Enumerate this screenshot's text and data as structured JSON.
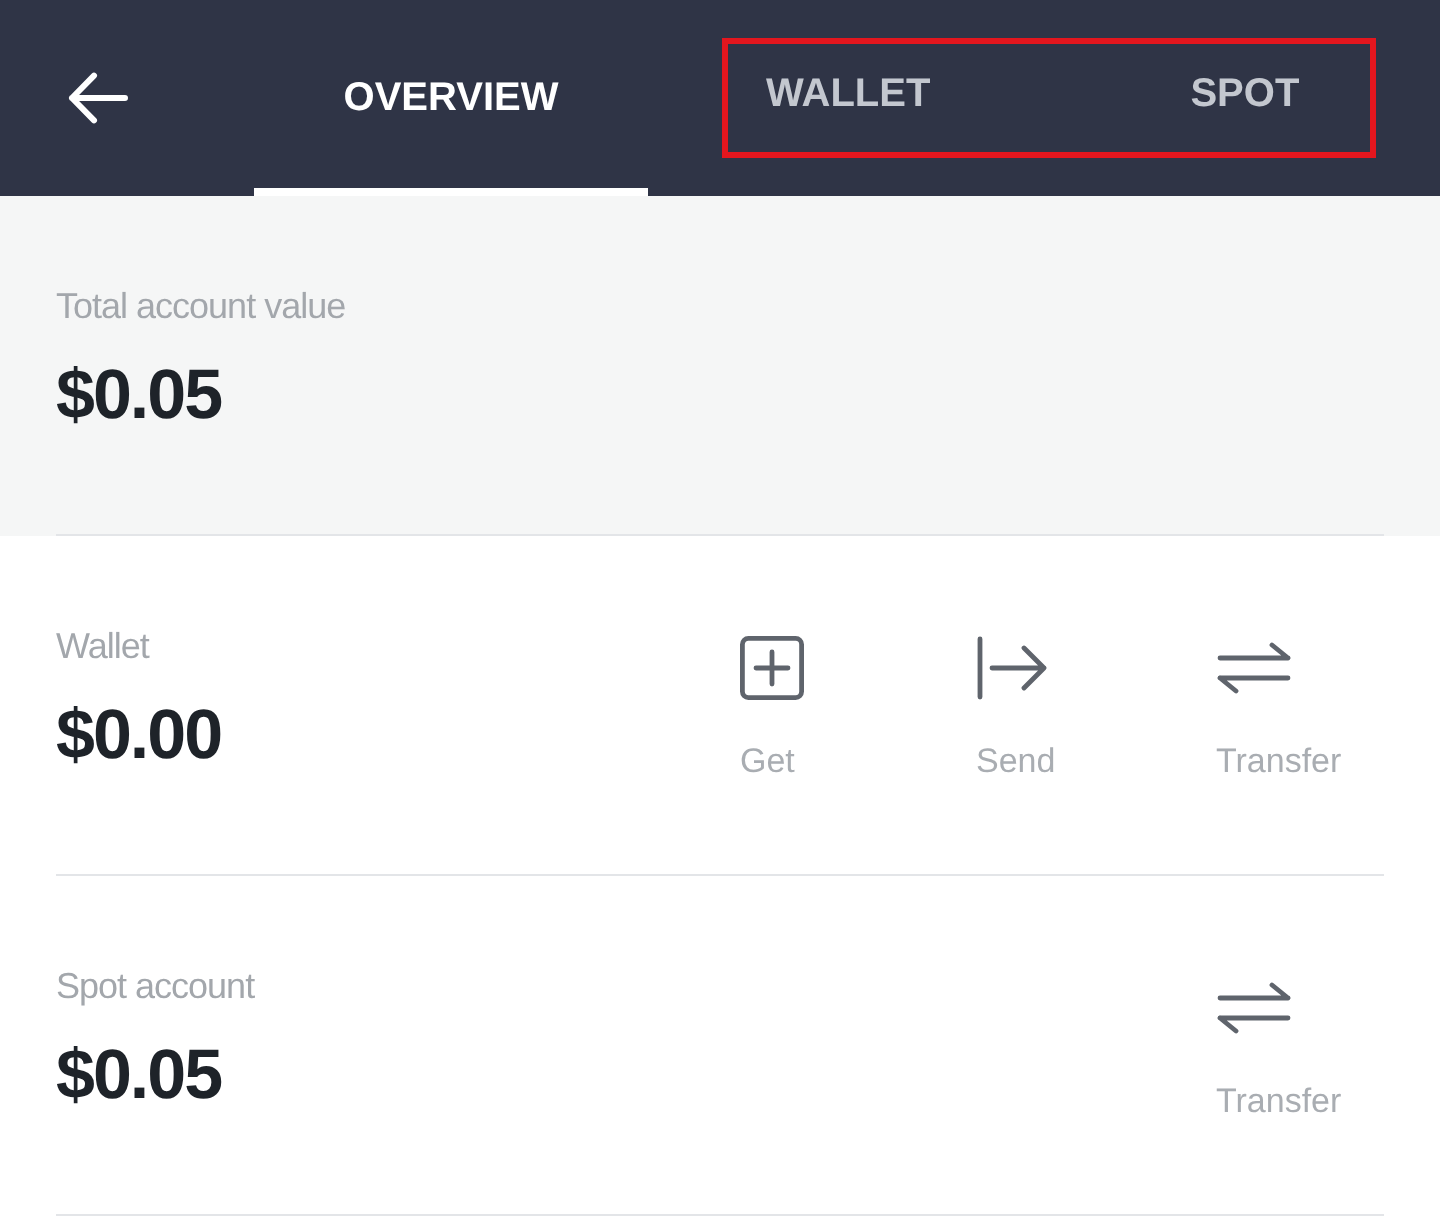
{
  "header": {
    "tabs": [
      {
        "label": "OVERVIEW",
        "selected": true,
        "highlighted": false
      },
      {
        "label": "WALLET",
        "selected": false,
        "highlighted": true
      },
      {
        "label": "SPOT",
        "selected": false,
        "highlighted": true
      }
    ]
  },
  "total": {
    "label": "Total account value",
    "value": "$0.05"
  },
  "accounts": [
    {
      "label": "Wallet",
      "value": "$0.00",
      "actions": [
        {
          "kind": "get",
          "label": "Get"
        },
        {
          "kind": "send",
          "label": "Send"
        },
        {
          "kind": "transfer",
          "label": "Transfer"
        }
      ]
    },
    {
      "label": "Spot account",
      "value": "$0.05",
      "actions": [
        {
          "kind": "transfer",
          "label": "Transfer"
        }
      ]
    }
  ]
}
